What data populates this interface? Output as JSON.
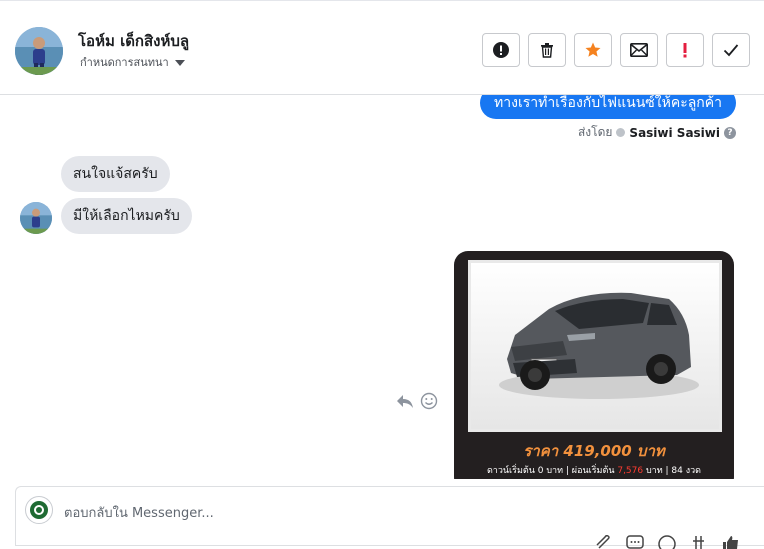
{
  "header": {
    "contact_name": "โอห์ม เด็กสิงห์บลู",
    "assign_label": "กำหนดการสนทนา",
    "actions": [
      {
        "name": "mark-spam",
        "icon": "exclamation-circle-icon"
      },
      {
        "name": "delete",
        "icon": "trash-icon"
      },
      {
        "name": "star",
        "icon": "star-icon"
      },
      {
        "name": "mark-unread",
        "icon": "envelope-icon"
      },
      {
        "name": "follow-up",
        "icon": "red-exclamation-icon"
      },
      {
        "name": "mark-done",
        "icon": "checkmark-icon"
      }
    ]
  },
  "thread": {
    "outgoing_message": "ทางเราทำเรื่องกับไฟแนนซ์ให้คะลูกค้า",
    "sent_by_label": "ส่งโดย",
    "sent_by_name": "Sasiwi Sasiwi",
    "incoming_messages": [
      "สนใจแจ้สครับ",
      "มีให้เลือกไหมครับ"
    ],
    "card": {
      "price_text": "ราคา 419,000 บาท",
      "subline_prefix": "ดาวน์เริ่มต้น 0 บาท | ผ่อนเริ่มต้น ",
      "subline_highlight": "7,576",
      "subline_suffix": " บาท | 84 งวด"
    }
  },
  "composer": {
    "placeholder": "ตอบกลับใน Messenger..."
  },
  "colors": {
    "accent_blue": "#1877f2",
    "bubble_gray": "#e4e6eb",
    "star_orange": "#f5821f",
    "alert_red": "#e41e3f",
    "price_orange": "#f2913d",
    "card_dark": "#231f20"
  }
}
